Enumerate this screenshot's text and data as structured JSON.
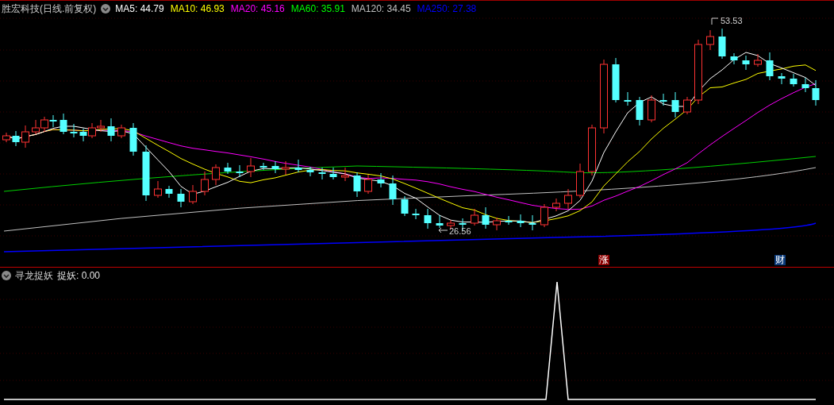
{
  "header": {
    "title": "胜宏科技(日线.前复权)",
    "indicators": [
      {
        "label": "MA5: 44.79",
        "color": "#ffffff"
      },
      {
        "label": "MA10: 46.93",
        "color": "#ffff00"
      },
      {
        "label": "MA20: 45.16",
        "color": "#ff00ff"
      },
      {
        "label": "MA60: 35.91",
        "color": "#00ff00"
      },
      {
        "label": "MA120: 34.45",
        "color": "#c0c0c0"
      },
      {
        "label": "MA250: 27.38",
        "color": "#0000ff"
      }
    ]
  },
  "price_chart": {
    "high_label": "53.53",
    "low_label": "26.56",
    "markers": [
      {
        "label": "涨",
        "color": "#8b0000"
      },
      {
        "label": "财",
        "color": "#0a3a7a"
      }
    ]
  },
  "indicator_panel": {
    "name": "寻龙捉妖",
    "reading": "捉妖: 0.00"
  }
}
